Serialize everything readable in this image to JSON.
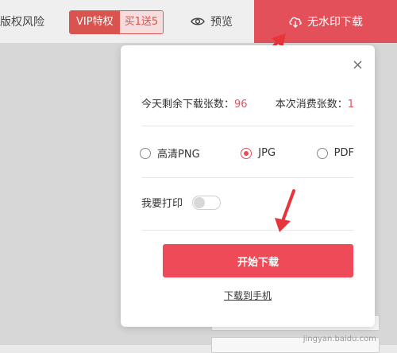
{
  "topbar": {
    "risk_label": "版权风险",
    "vip_label": "VIP特权",
    "promo_label": "买1送5",
    "preview_label": "预览",
    "download_label": "无水印下载"
  },
  "modal": {
    "remaining_label": "今天剩余下载张数：",
    "remaining_value": "96",
    "cost_label": "本次消费张数：",
    "cost_value": "1",
    "formats": [
      "高清PNG",
      "JPG",
      "PDF"
    ],
    "selected_format": "JPG",
    "print_label": "我要打印",
    "start_button": "开始下载",
    "phone_link": "下载到手机"
  },
  "watermark": "jingyan.baidu.com",
  "colors": {
    "accent": "#ef4a57",
    "arrow": "#e8343b"
  }
}
